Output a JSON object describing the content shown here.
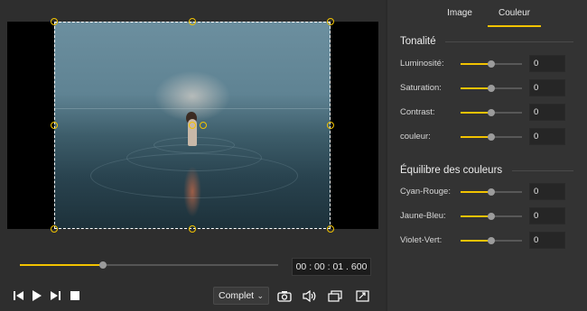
{
  "player": {
    "timecode": "00 : 00 : 01 . 600",
    "progress": 0.32,
    "zoom_option": "Complet",
    "controls": [
      "previous-frame-icon",
      "play-icon",
      "next-frame-icon",
      "stop-icon"
    ],
    "tools": [
      "camera-icon",
      "volume-icon",
      "copy-window-icon",
      "fullscreen-icon"
    ]
  },
  "tabs": [
    {
      "label": "Image"
    },
    {
      "label": "Couleur"
    }
  ],
  "tonalite": {
    "title": "Tonalité",
    "items": [
      {
        "label": "Luminosité:",
        "value": "0",
        "level": 0.5
      },
      {
        "label": "Saturation:",
        "value": "0",
        "level": 0.5
      },
      {
        "label": "Contrast:",
        "value": "0",
        "level": 0.5
      },
      {
        "label": "couleur:",
        "value": "0",
        "level": 0.5
      }
    ]
  },
  "equilibre": {
    "title": "Équilibre des couleurs",
    "items": [
      {
        "label": "Cyan-Rouge:",
        "value": "0",
        "level": 0.5
      },
      {
        "label": "Jaune-Bleu:",
        "value": "0",
        "level": 0.5
      },
      {
        "label": "Violet-Vert:",
        "value": "0",
        "level": 0.5
      }
    ]
  },
  "colors": {
    "accent": "#f2c300",
    "panel": "#333333",
    "editor": "#2e2e2e"
  }
}
